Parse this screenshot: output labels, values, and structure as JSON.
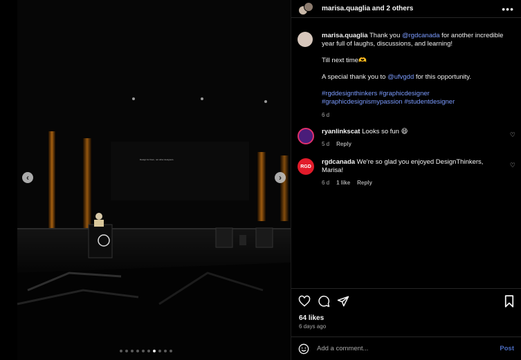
{
  "header": {
    "title": "marisa.quaglia and 2 others",
    "more_icon": "more-horizontal-icon"
  },
  "media": {
    "screen_text": "Design for them, not other designers.",
    "slide_count": 10,
    "active_slide": 7
  },
  "caption": {
    "username": "marisa.quaglia",
    "text_1": " Thank you ",
    "mention_1": "@rgdcanada",
    "text_2": " for another incredible year full of laughs, discussions, and learning!",
    "line_2": "Till next time🫶",
    "text_3": "A special thank you to ",
    "mention_2": "@ufvgdd",
    "text_4": " for this opportunity.",
    "hashtags": "#rgddesignthinkers #graphicdesigner #graphicdesignismypassion #studentdesigner",
    "time": "6 d"
  },
  "comments": [
    {
      "username": "ryanlinkscat",
      "text": " Looks so fun 😄",
      "time": "5 d",
      "reply": "Reply"
    },
    {
      "username": "rgdcanada",
      "avatar_text": "RGD",
      "text": " We're so glad you enjoyed DesignThinkers, Marisa!",
      "time": "6 d",
      "likes": "1 like",
      "reply": "Reply"
    }
  ],
  "actions": {
    "likes": "64 likes",
    "ago": "6 days ago"
  },
  "add_comment": {
    "placeholder": "Add a comment...",
    "post_label": "Post"
  },
  "colors": {
    "link": "#7c9cff",
    "post": "#4a6bbf",
    "background": "#000000"
  }
}
